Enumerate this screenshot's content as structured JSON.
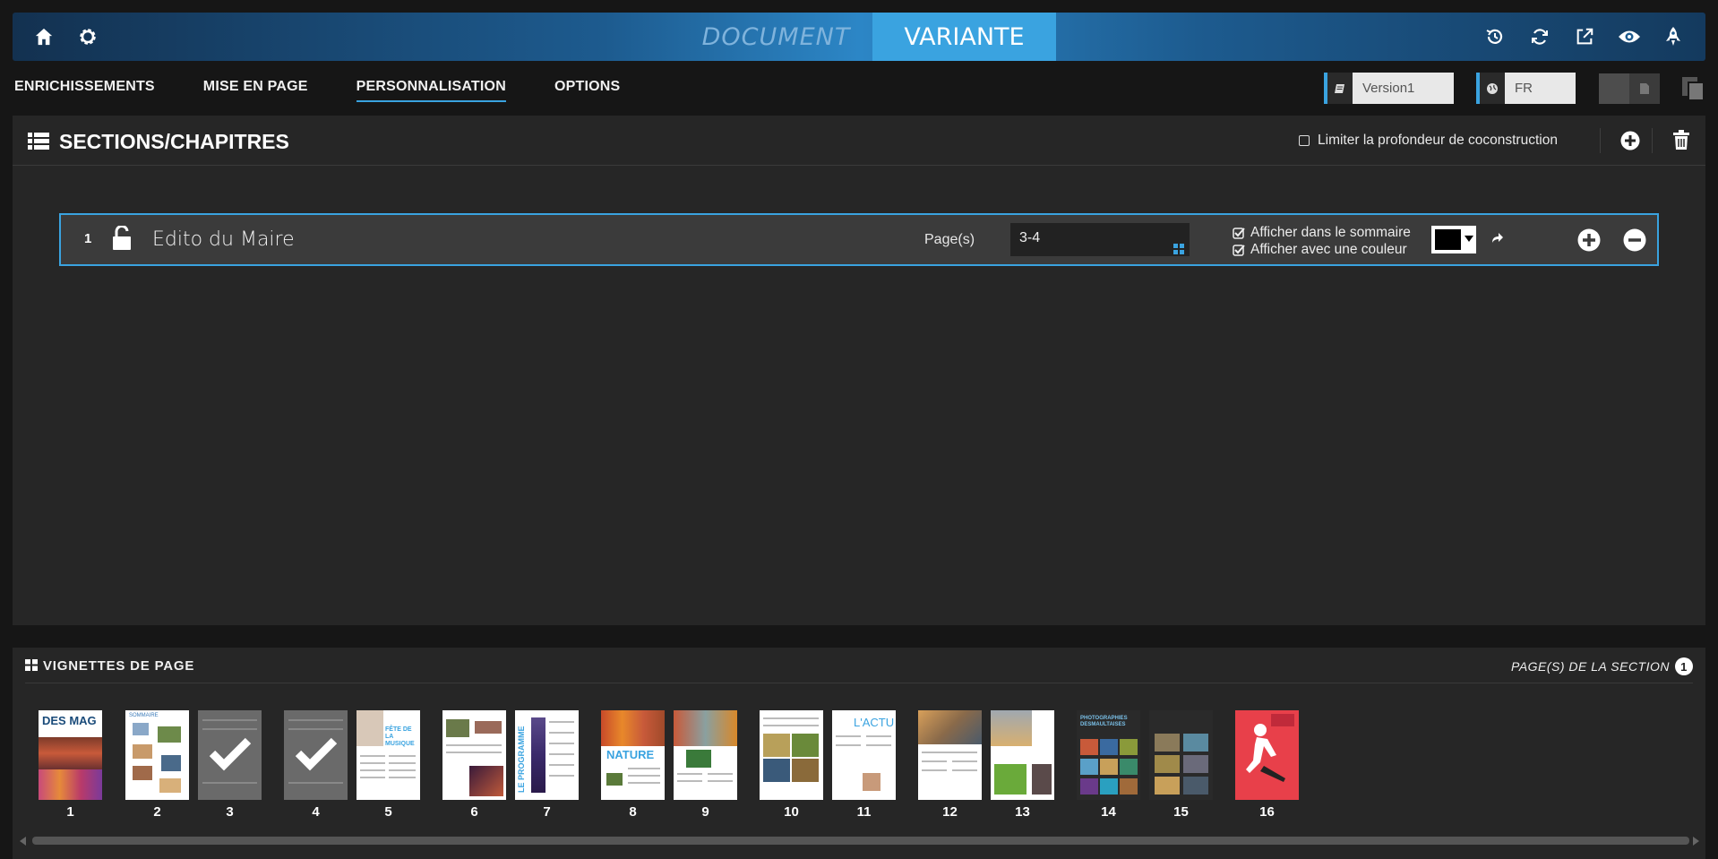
{
  "topbar": {
    "tab_document": "DOCUMENT",
    "tab_variante": "VARIANTE",
    "accent": "#3aa3e0"
  },
  "menu": {
    "items": [
      {
        "label": "ENRICHISSEMENTS"
      },
      {
        "label": "MISE EN PAGE"
      },
      {
        "label": "PERSONNALISATION",
        "active": true
      },
      {
        "label": "OPTIONS"
      }
    ]
  },
  "version_select": {
    "value": "Version1",
    "icon": "book-icon"
  },
  "language_select": {
    "value": "FR",
    "icon": "globe-icon"
  },
  "sections": {
    "title": "SECTIONS/CHAPITRES",
    "limit_label": "Limiter la profondeur de coconstruction",
    "limit_checked": false,
    "rows": [
      {
        "number": "1",
        "title": "Edito du Maire",
        "pages_label": "Page(s)",
        "pages_value": "3-4",
        "show_in_summary_label": "Afficher dans le sommaire",
        "show_in_summary": true,
        "show_with_color_label": "Afficher avec une couleur",
        "show_with_color": true,
        "color": "#000000"
      }
    ]
  },
  "thumbnails": {
    "title": "VIGNETTES DE PAGE",
    "section_pages_label": "PAGE(S) DE LA SECTION",
    "section_pages_count": "1",
    "pages": [
      {
        "n": "1",
        "cover_text": "DES MAG"
      },
      {
        "n": "2",
        "cover_text": "SOMMAIRE"
      },
      {
        "n": "3",
        "selected": true
      },
      {
        "n": "4",
        "selected": true
      },
      {
        "n": "5",
        "cover_text": "FÊTE DE LA MUSIQUE"
      },
      {
        "n": "6"
      },
      {
        "n": "7",
        "cover_text": "LE PROGRAMME"
      },
      {
        "n": "8",
        "cover_text": "NATURE"
      },
      {
        "n": "9"
      },
      {
        "n": "10"
      },
      {
        "n": "11",
        "cover_text": "L'ACTU"
      },
      {
        "n": "12"
      },
      {
        "n": "13"
      },
      {
        "n": "14",
        "cover_text": "PHOTOGRAPHIES DESMAULTAISES"
      },
      {
        "n": "15"
      },
      {
        "n": "16"
      }
    ]
  }
}
